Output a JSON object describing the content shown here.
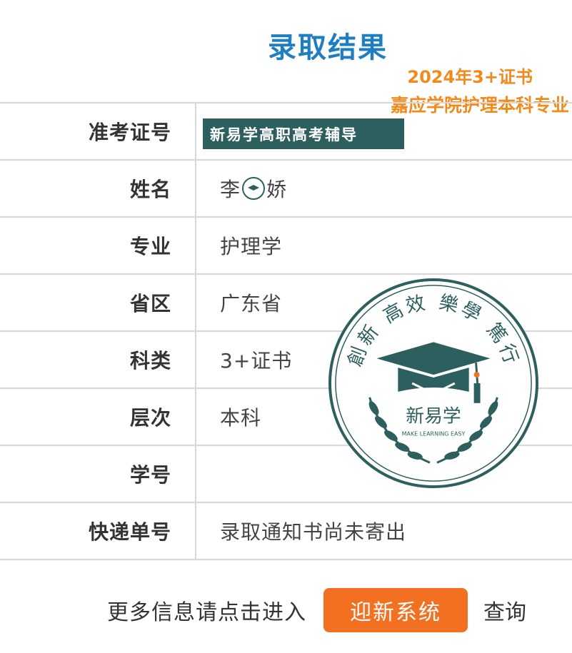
{
  "page": {
    "title": "录取结果"
  },
  "annotations": {
    "line1": "2024年3+证书",
    "line2": "嘉应学院护理本科专业"
  },
  "overlay_banner": "新易学高职高考辅导",
  "rows": [
    {
      "label": "准考证号",
      "value": ""
    },
    {
      "label": "姓名",
      "value_before": "李",
      "value_after": "娇"
    },
    {
      "label": "专业",
      "value": "护理学"
    },
    {
      "label": "省区",
      "value": "广东省"
    },
    {
      "label": "科类",
      "value": "3+证书"
    },
    {
      "label": "层次",
      "value": "本科"
    },
    {
      "label": "学号",
      "value": ""
    },
    {
      "label": "快递单号",
      "value": "录取通知书尚未寄出"
    }
  ],
  "footer": {
    "prompt": "更多信息请点击进入",
    "button": "迎新系统",
    "suffix": "查询"
  },
  "seal": {
    "top_text": "創新 高效 樂學 篤行",
    "brand": "新易学",
    "tagline": "MAKE LEARNING EASY"
  },
  "colors": {
    "title": "#1f7ec2",
    "accent": "#f37021",
    "annotation": "#f28a1b",
    "seal": "#2e5f5f"
  }
}
